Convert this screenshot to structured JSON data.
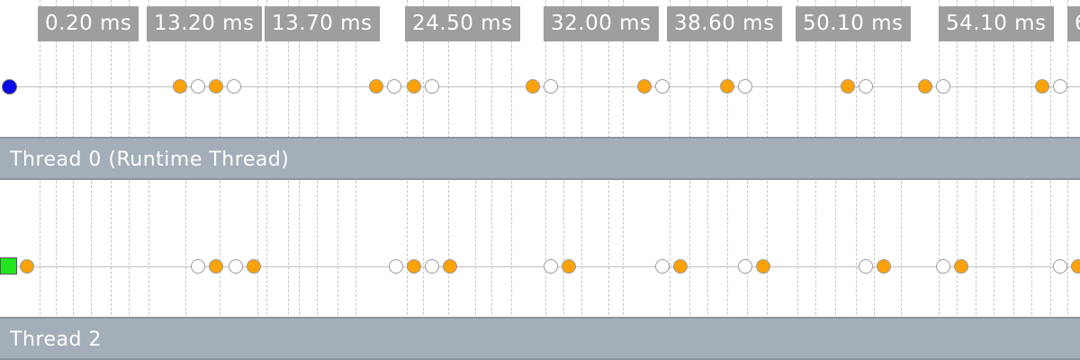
{
  "colors": {
    "event_fill": "#fba20a",
    "event_open": "#ffffff",
    "thread0_start_marker": "#0a0ae6",
    "thread2_start_marker": "#22e51f",
    "thread_header_bg": "#a4aeb8",
    "time_label_bg": "#9e9e9e"
  },
  "time_labels": [
    "0.20 ms",
    "13.20 ms",
    "13.70 ms",
    "24.50 ms",
    "32.00 ms",
    "38.60 ms",
    "50.10 ms",
    "54.10 ms",
    "6"
  ],
  "threads": [
    {
      "label": "Thread 0 (Runtime Thread)",
      "start_marker": "circle"
    },
    {
      "label": "Thread 2",
      "start_marker": "square"
    }
  ],
  "icons": {
    "filled_event": "filled-event-icon",
    "open_event": "open-event-icon",
    "thread0_start": "thread-start-circle-icon",
    "thread2_start": "thread-start-square-icon"
  }
}
